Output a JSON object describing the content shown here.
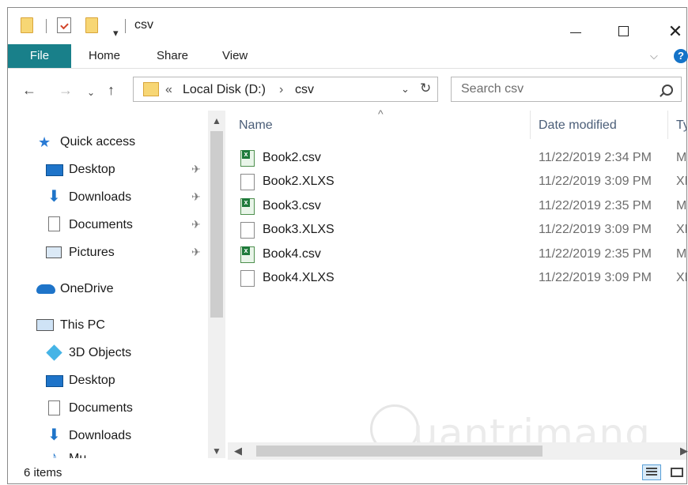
{
  "window": {
    "title": "csv",
    "controls": {
      "minimize": "minimize",
      "maximize": "maximize",
      "close": "✕"
    }
  },
  "quick_access_toolbar": {
    "dropdown": "▾"
  },
  "ribbon": {
    "tabs": [
      {
        "label": "File"
      },
      {
        "label": "Home"
      },
      {
        "label": "Share"
      },
      {
        "label": "View"
      }
    ],
    "expand": "⌵",
    "help": "?"
  },
  "nav": {
    "back": "←",
    "forward": "→",
    "recent": "⌄",
    "up": "↑",
    "address": {
      "overflow": "«",
      "segments": [
        "Local Disk (D:)",
        "csv"
      ],
      "separator": "›",
      "dropdown": "⌄",
      "refresh": "↻"
    },
    "search_placeholder": "Search csv"
  },
  "sidebar": {
    "quick_access": "Quick access",
    "items": [
      {
        "label": "Desktop",
        "icon": "desktop-icon",
        "pinned": true
      },
      {
        "label": "Downloads",
        "icon": "downloads-icon",
        "pinned": true
      },
      {
        "label": "Documents",
        "icon": "documents-icon",
        "pinned": true
      },
      {
        "label": "Pictures",
        "icon": "pictures-icon",
        "pinned": true
      }
    ],
    "onedrive": "OneDrive",
    "this_pc": "This PC",
    "pc_items": [
      {
        "label": "3D Objects",
        "icon": "3d-objects-icon"
      },
      {
        "label": "Desktop",
        "icon": "desktop-icon"
      },
      {
        "label": "Documents",
        "icon": "documents-icon"
      },
      {
        "label": "Downloads",
        "icon": "downloads-icon"
      },
      {
        "label": "Mu",
        "icon": "music-icon"
      }
    ],
    "pin_glyph": "📌"
  },
  "columns": {
    "name": "Name",
    "date_modified": "Date modified",
    "type": "Ty",
    "sort_glyph": "^"
  },
  "files": [
    {
      "name": "Book2.csv",
      "date": "11/22/2019 2:34 PM",
      "type": "M",
      "icon": "excel-csv-icon"
    },
    {
      "name": "Book2.XLXS",
      "date": "11/22/2019 3:09 PM",
      "type": "XL",
      "icon": "blank-file-icon"
    },
    {
      "name": "Book3.csv",
      "date": "11/22/2019 2:35 PM",
      "type": "M",
      "icon": "excel-csv-icon"
    },
    {
      "name": "Book3.XLXS",
      "date": "11/22/2019 3:09 PM",
      "type": "XL",
      "icon": "blank-file-icon"
    },
    {
      "name": "Book4.csv",
      "date": "11/22/2019 2:35 PM",
      "type": "M",
      "icon": "excel-csv-icon"
    },
    {
      "name": "Book4.XLXS",
      "date": "11/22/2019 3:09 PM",
      "type": "XL",
      "icon": "blank-file-icon"
    }
  ],
  "scrollbars": {
    "up": "▲",
    "down": "▼",
    "left": "◀",
    "right": "▶"
  },
  "status": {
    "item_count": "6 items"
  },
  "watermark": "uantrimang",
  "colors": {
    "file_tab": "#19808a",
    "folder": "#f7d674",
    "help": "#1473c8"
  }
}
